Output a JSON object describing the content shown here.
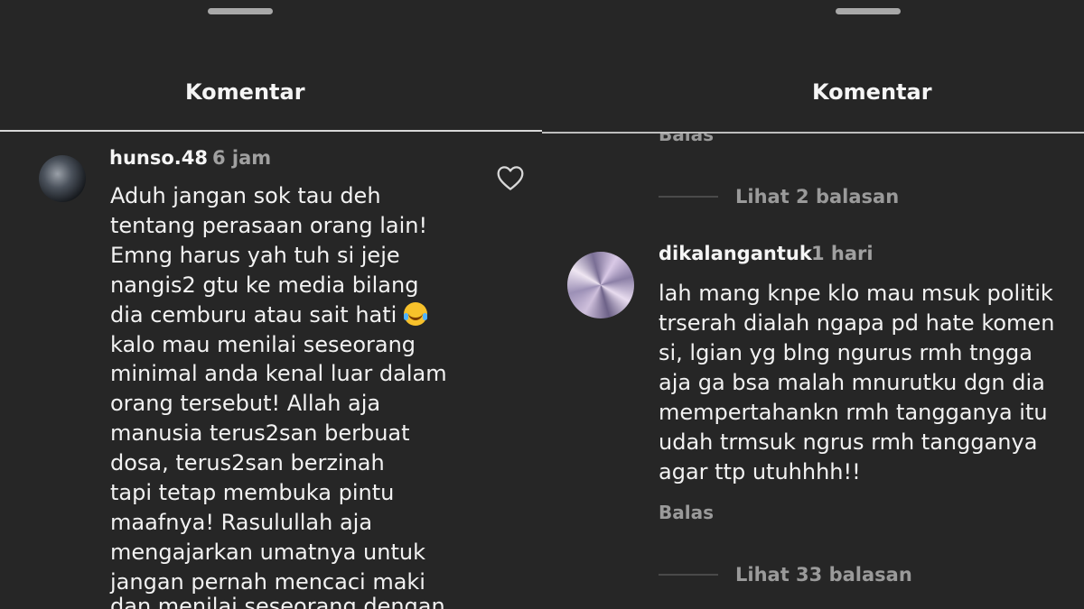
{
  "left": {
    "header": {
      "title": "Komentar"
    },
    "comment": {
      "username": "hunso.48",
      "time": "6 jam",
      "lines": [
        "Aduh jangan sok tau deh",
        "tentang perasaan orang lain!",
        "Emng harus yah tuh si jeje",
        "nangis2 gtu ke media bilang",
        "dia cemburu atau sait hati",
        "kalo mau menilai seseorang",
        "minimal anda kenal luar dalam",
        "orang tersebut! Allah aja",
        "manusia terus2san berbuat",
        "dosa, terus2san berzinah",
        "tapi tetap membuka pintu",
        "maafnya! Rasulullah aja",
        "mengajarkan umatnya untuk",
        "jangan pernah mencaci maki",
        "dan menilai seseorang dengan"
      ]
    }
  },
  "right": {
    "header": {
      "title": "Komentar"
    },
    "top_reply": "Balas",
    "view_replies_1": "Lihat 2 balasan",
    "comment": {
      "username": "dikalangantuk",
      "time": "1 hari",
      "lines": [
        "lah mang knpe klo mau msuk politik",
        "trserah dialah ngapa pd hate komen",
        "si, lgian yg blng ngurus rmh tngga",
        "aja ga bsa malah mnurutku dgn dia",
        "mempertahankn rmh tangganya itu",
        "udah trmsuk ngrus rmh tangganya",
        "agar ttp utuhhhh!!"
      ],
      "reply": "Balas"
    },
    "view_replies_2": "Lihat 33 balasan"
  }
}
